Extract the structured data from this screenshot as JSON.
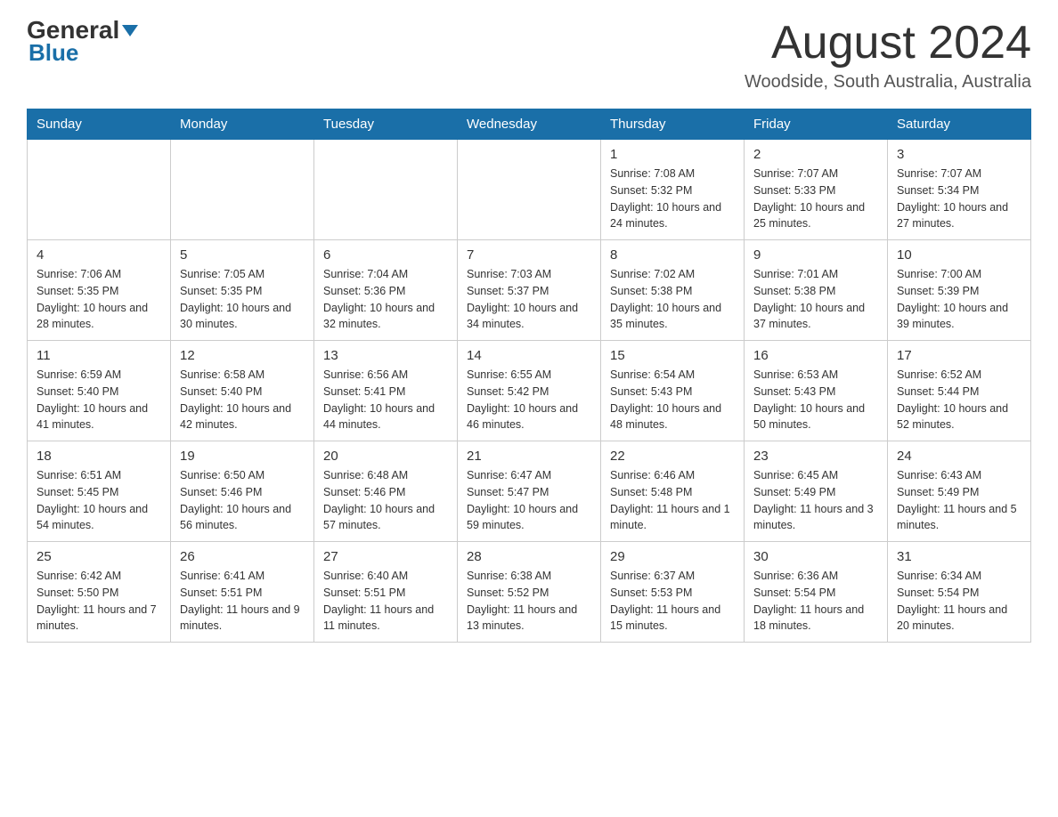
{
  "header": {
    "logo_general": "General",
    "logo_blue": "Blue",
    "month_year": "August 2024",
    "location": "Woodside, South Australia, Australia"
  },
  "weekdays": [
    "Sunday",
    "Monday",
    "Tuesday",
    "Wednesday",
    "Thursday",
    "Friday",
    "Saturday"
  ],
  "weeks": [
    [
      {
        "day": "",
        "info": ""
      },
      {
        "day": "",
        "info": ""
      },
      {
        "day": "",
        "info": ""
      },
      {
        "day": "",
        "info": ""
      },
      {
        "day": "1",
        "info": "Sunrise: 7:08 AM\nSunset: 5:32 PM\nDaylight: 10 hours and 24 minutes."
      },
      {
        "day": "2",
        "info": "Sunrise: 7:07 AM\nSunset: 5:33 PM\nDaylight: 10 hours and 25 minutes."
      },
      {
        "day": "3",
        "info": "Sunrise: 7:07 AM\nSunset: 5:34 PM\nDaylight: 10 hours and 27 minutes."
      }
    ],
    [
      {
        "day": "4",
        "info": "Sunrise: 7:06 AM\nSunset: 5:35 PM\nDaylight: 10 hours and 28 minutes."
      },
      {
        "day": "5",
        "info": "Sunrise: 7:05 AM\nSunset: 5:35 PM\nDaylight: 10 hours and 30 minutes."
      },
      {
        "day": "6",
        "info": "Sunrise: 7:04 AM\nSunset: 5:36 PM\nDaylight: 10 hours and 32 minutes."
      },
      {
        "day": "7",
        "info": "Sunrise: 7:03 AM\nSunset: 5:37 PM\nDaylight: 10 hours and 34 minutes."
      },
      {
        "day": "8",
        "info": "Sunrise: 7:02 AM\nSunset: 5:38 PM\nDaylight: 10 hours and 35 minutes."
      },
      {
        "day": "9",
        "info": "Sunrise: 7:01 AM\nSunset: 5:38 PM\nDaylight: 10 hours and 37 minutes."
      },
      {
        "day": "10",
        "info": "Sunrise: 7:00 AM\nSunset: 5:39 PM\nDaylight: 10 hours and 39 minutes."
      }
    ],
    [
      {
        "day": "11",
        "info": "Sunrise: 6:59 AM\nSunset: 5:40 PM\nDaylight: 10 hours and 41 minutes."
      },
      {
        "day": "12",
        "info": "Sunrise: 6:58 AM\nSunset: 5:40 PM\nDaylight: 10 hours and 42 minutes."
      },
      {
        "day": "13",
        "info": "Sunrise: 6:56 AM\nSunset: 5:41 PM\nDaylight: 10 hours and 44 minutes."
      },
      {
        "day": "14",
        "info": "Sunrise: 6:55 AM\nSunset: 5:42 PM\nDaylight: 10 hours and 46 minutes."
      },
      {
        "day": "15",
        "info": "Sunrise: 6:54 AM\nSunset: 5:43 PM\nDaylight: 10 hours and 48 minutes."
      },
      {
        "day": "16",
        "info": "Sunrise: 6:53 AM\nSunset: 5:43 PM\nDaylight: 10 hours and 50 minutes."
      },
      {
        "day": "17",
        "info": "Sunrise: 6:52 AM\nSunset: 5:44 PM\nDaylight: 10 hours and 52 minutes."
      }
    ],
    [
      {
        "day": "18",
        "info": "Sunrise: 6:51 AM\nSunset: 5:45 PM\nDaylight: 10 hours and 54 minutes."
      },
      {
        "day": "19",
        "info": "Sunrise: 6:50 AM\nSunset: 5:46 PM\nDaylight: 10 hours and 56 minutes."
      },
      {
        "day": "20",
        "info": "Sunrise: 6:48 AM\nSunset: 5:46 PM\nDaylight: 10 hours and 57 minutes."
      },
      {
        "day": "21",
        "info": "Sunrise: 6:47 AM\nSunset: 5:47 PM\nDaylight: 10 hours and 59 minutes."
      },
      {
        "day": "22",
        "info": "Sunrise: 6:46 AM\nSunset: 5:48 PM\nDaylight: 11 hours and 1 minute."
      },
      {
        "day": "23",
        "info": "Sunrise: 6:45 AM\nSunset: 5:49 PM\nDaylight: 11 hours and 3 minutes."
      },
      {
        "day": "24",
        "info": "Sunrise: 6:43 AM\nSunset: 5:49 PM\nDaylight: 11 hours and 5 minutes."
      }
    ],
    [
      {
        "day": "25",
        "info": "Sunrise: 6:42 AM\nSunset: 5:50 PM\nDaylight: 11 hours and 7 minutes."
      },
      {
        "day": "26",
        "info": "Sunrise: 6:41 AM\nSunset: 5:51 PM\nDaylight: 11 hours and 9 minutes."
      },
      {
        "day": "27",
        "info": "Sunrise: 6:40 AM\nSunset: 5:51 PM\nDaylight: 11 hours and 11 minutes."
      },
      {
        "day": "28",
        "info": "Sunrise: 6:38 AM\nSunset: 5:52 PM\nDaylight: 11 hours and 13 minutes."
      },
      {
        "day": "29",
        "info": "Sunrise: 6:37 AM\nSunset: 5:53 PM\nDaylight: 11 hours and 15 minutes."
      },
      {
        "day": "30",
        "info": "Sunrise: 6:36 AM\nSunset: 5:54 PM\nDaylight: 11 hours and 18 minutes."
      },
      {
        "day": "31",
        "info": "Sunrise: 6:34 AM\nSunset: 5:54 PM\nDaylight: 11 hours and 20 minutes."
      }
    ]
  ]
}
